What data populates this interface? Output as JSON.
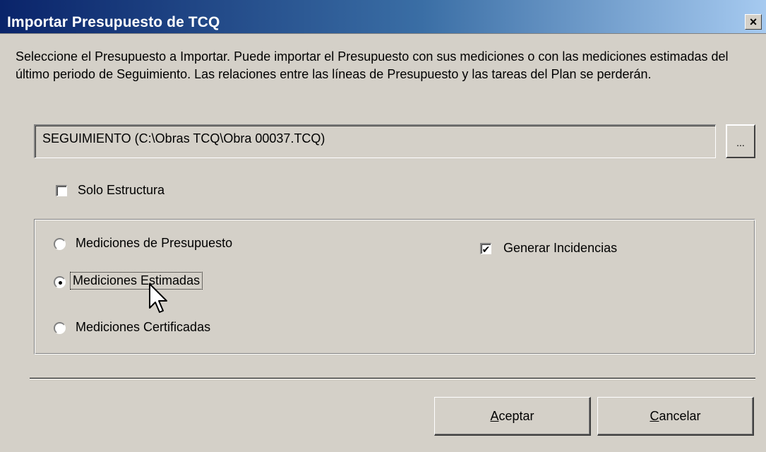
{
  "window": {
    "title": "Importar Presupuesto de TCQ",
    "close_label": "×"
  },
  "description": "Seleccione el Presupuesto a Importar. Puede importar el Presupuesto con sus mediciones o con las mediciones estimadas del último periodo de Seguimiento. Las relaciones entre las líneas de Presupuesto y las tareas del Plan se perderán.",
  "path": {
    "value": "SEGUIMIENTO (C:\\Obras TCQ\\Obra 00037.TCQ)",
    "browse_label": "..."
  },
  "solo_estructura": {
    "label": "Solo Estructura",
    "checked": false
  },
  "mediciones": {
    "options": [
      {
        "label": "Mediciones de Presupuesto",
        "selected": false
      },
      {
        "label": "Mediciones Estimadas",
        "selected": true
      },
      {
        "label": "Mediciones Certificadas",
        "selected": false
      }
    ]
  },
  "generar_incidencias": {
    "label": "Generar Incidencias",
    "checked": true
  },
  "buttons": {
    "accept": {
      "mnemonic": "A",
      "rest": "ceptar"
    },
    "cancel": {
      "mnemonic": "C",
      "rest": "ancelar"
    }
  },
  "colors": {
    "face": "#d4d0c8",
    "title_start": "#0a246a",
    "title_end": "#a6caf0"
  }
}
